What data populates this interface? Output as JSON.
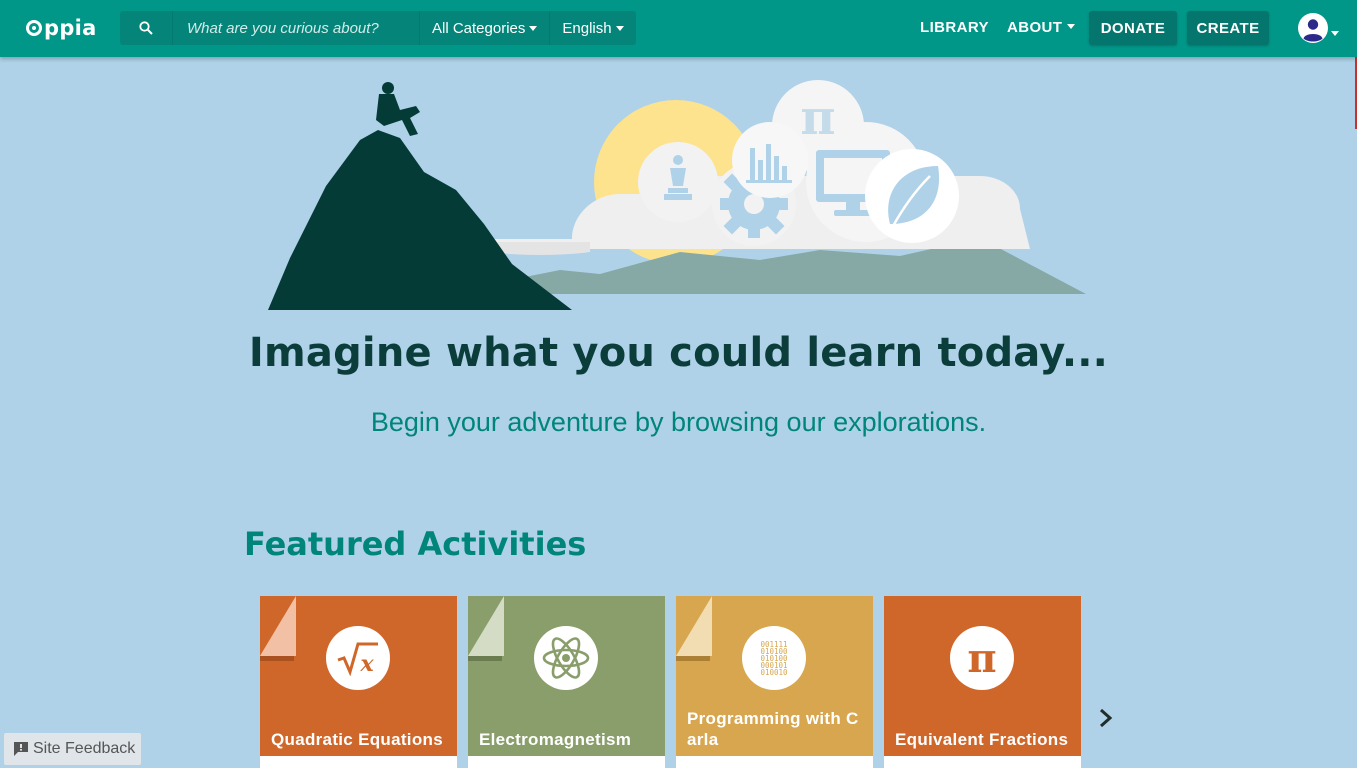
{
  "app": {
    "logo_text": "ppia"
  },
  "search": {
    "placeholder": "What are you curious about?",
    "category": "All Categories",
    "language": "English"
  },
  "nav": {
    "library": "LIBRARY",
    "about": "ABOUT",
    "donate": "DONATE",
    "create": "CREATE"
  },
  "hero": {
    "title": "Imagine what you could learn today...",
    "subtitle": "Begin your adventure by browsing our explorations."
  },
  "featured": {
    "title": "Featured Activities",
    "cards": [
      {
        "title": "Quadratic Equations",
        "color": "#d0672a",
        "icon": "square-root-icon"
      },
      {
        "title": "Electromagnetism",
        "color": "#8a9e6b",
        "icon": "atom-icon"
      },
      {
        "title": "Programming with Carla",
        "color": "#d8a64f",
        "icon": "binary-code-icon"
      },
      {
        "title": "Equivalent Fractions",
        "color": "#d0672a",
        "icon": "pi-icon"
      }
    ]
  },
  "feedback": {
    "label": "Site Feedback"
  },
  "colors": {
    "topbar": "#009688",
    "background": "#afd2e9",
    "button_dark": "#05766d",
    "title": "#0b3d3b",
    "accent_text": "#00857a"
  }
}
